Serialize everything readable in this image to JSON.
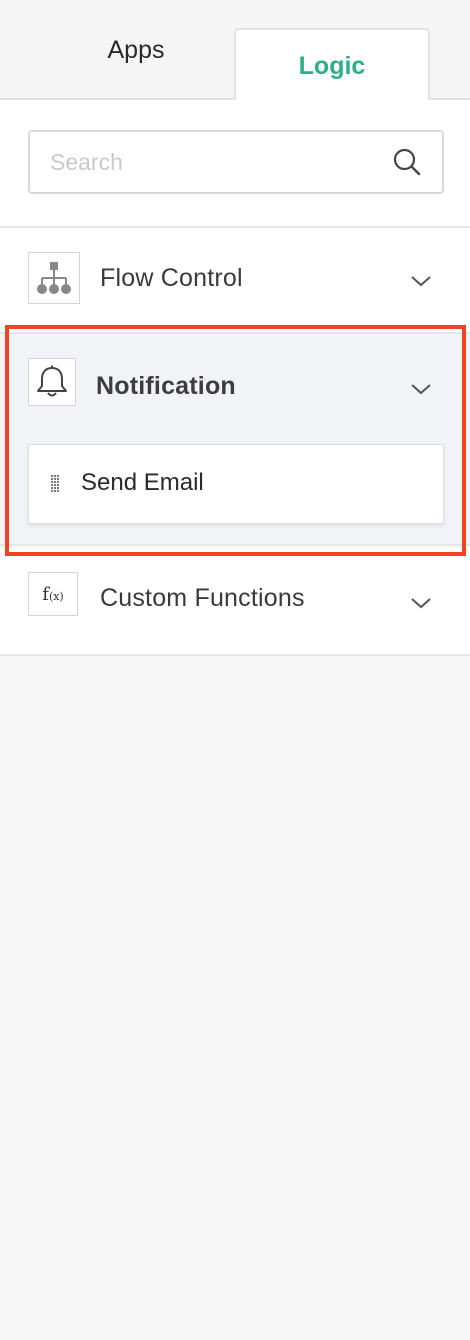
{
  "tabs": [
    {
      "label": "Apps",
      "active": false
    },
    {
      "label": "Logic",
      "active": true
    }
  ],
  "search": {
    "placeholder": "Search",
    "value": "",
    "icon": "search-icon"
  },
  "sections": {
    "flow_control": {
      "label": "Flow Control",
      "icon": "hierarchy-icon",
      "expanded": false
    },
    "notification": {
      "label": "Notification",
      "icon": "bell-icon",
      "expanded": true,
      "items": [
        {
          "label": "Send Email",
          "icon": "drag-handle-icon"
        }
      ]
    },
    "custom_functions": {
      "label": "Custom Functions",
      "icon_text": "f",
      "icon_sub": "(x)",
      "expanded": false
    }
  },
  "colors": {
    "accent": "#2bb08b",
    "highlight": "#f0431f",
    "text": "#333333"
  }
}
